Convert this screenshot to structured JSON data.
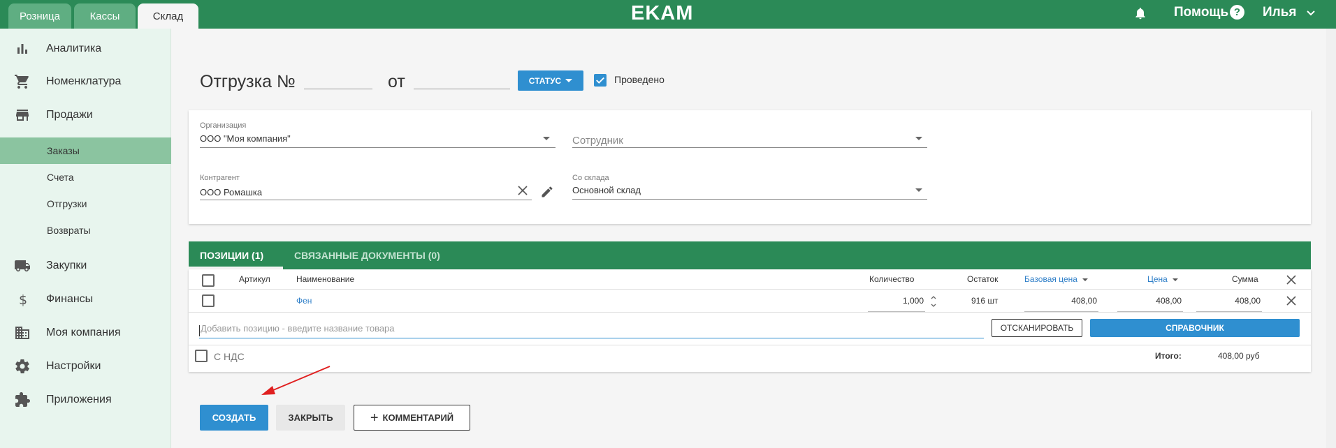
{
  "topbar": {
    "tabs": [
      {
        "label": "Розница"
      },
      {
        "label": "Кассы"
      },
      {
        "label": "Склад"
      }
    ],
    "logo": "EKAM",
    "help_label": "Помощь",
    "help_icon": "?",
    "user_name": "Илья"
  },
  "sidebar": {
    "items": [
      {
        "label": "Аналитика",
        "icon": "chart-icon"
      },
      {
        "label": "Номенклатура",
        "icon": "cart-icon"
      },
      {
        "label": "Продажи",
        "icon": "store-icon"
      },
      {
        "label": "Закупки",
        "icon": "truck-icon"
      },
      {
        "label": "Финансы",
        "icon": "dollar-icon"
      },
      {
        "label": "Моя компания",
        "icon": "building-icon"
      },
      {
        "label": "Настройки",
        "icon": "gear-icon"
      },
      {
        "label": "Приложения",
        "icon": "puzzle-icon"
      }
    ],
    "sub_items": [
      {
        "label": "Заказы",
        "active": true
      },
      {
        "label": "Счета"
      },
      {
        "label": "Отгрузки"
      },
      {
        "label": "Возвраты"
      }
    ]
  },
  "document": {
    "title": "Отгрузка  №",
    "number": "",
    "from_label": "от",
    "date": "",
    "status_label": "СТАТУС",
    "posted_label": "Проведено",
    "posted_checked": true
  },
  "form": {
    "organization_label": "Организация",
    "organization_value": "ООО \"Моя компания\"",
    "employee_placeholder": "Сотрудник",
    "counterparty_label": "Контрагент",
    "counterparty_value": "ООО Ромашка",
    "warehouse_label": "Со склада",
    "warehouse_value": "Основной склад"
  },
  "tabs": [
    {
      "label": "ПОЗИЦИИ (1)",
      "active": true
    },
    {
      "label": "СВЯЗАННЫЕ ДОКУМЕНТЫ (0)",
      "active": false
    }
  ],
  "table": {
    "columns": {
      "article": "Артикул",
      "name": "Наименование",
      "quantity": "Количество",
      "stock": "Остаток",
      "base_price": "Базовая цена",
      "price": "Цена",
      "sum": "Сумма"
    },
    "rows": [
      {
        "article": "",
        "name": "Фен",
        "quantity": "1,000",
        "stock": "916 шт",
        "base_price": "408,00",
        "price": "408,00",
        "sum": "408,00"
      }
    ],
    "add_placeholder": "Добавить позицию - введите название товара",
    "scan_label": "ОТСКАНИРОВАТЬ",
    "directory_label": "СПРАВОЧНИК",
    "vat_label": "С НДС",
    "total_label": "Итого:",
    "total_value": "408,00 руб"
  },
  "actions": {
    "create_label": "СОЗДАТЬ",
    "close_label": "ЗАКРЫТЬ",
    "comment_label": "КОММЕНТАРИЙ"
  },
  "colors": {
    "brand_green": "#2b8a57",
    "accent_blue": "#2f8fd0",
    "annotation_red": "#e02020"
  }
}
